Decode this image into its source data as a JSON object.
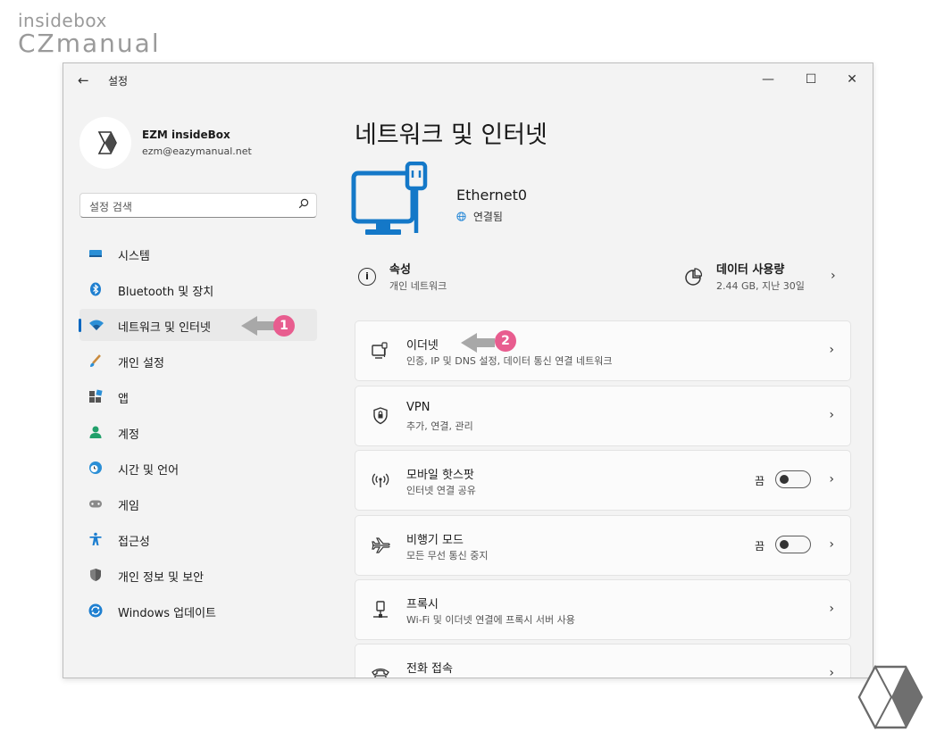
{
  "brand": {
    "line1": "insidebox",
    "line2": "CZmanual"
  },
  "window": {
    "title": "설정",
    "back_icon": "←",
    "minimize": "—",
    "maximize": "☐",
    "close": "✕"
  },
  "profile": {
    "name": "EZM insideBox",
    "email": "ezm@eazymanual.net"
  },
  "search": {
    "placeholder": "설정 검색",
    "icon": "search-icon"
  },
  "sidebar": {
    "items": [
      {
        "label": "시스템",
        "icon": "system-display-icon",
        "active": false
      },
      {
        "label": "Bluetooth 및 장치",
        "icon": "bluetooth-icon",
        "active": false
      },
      {
        "label": "네트워크 및 인터넷",
        "icon": "wifi-network-icon",
        "active": true
      },
      {
        "label": "개인 설정",
        "icon": "brush-icon",
        "active": false
      },
      {
        "label": "앱",
        "icon": "apps-icon",
        "active": false
      },
      {
        "label": "계정",
        "icon": "account-icon",
        "active": false
      },
      {
        "label": "시간 및 언어",
        "icon": "clock-globe-icon",
        "active": false
      },
      {
        "label": "게임",
        "icon": "gamepad-icon",
        "active": false
      },
      {
        "label": "접근성",
        "icon": "accessibility-icon",
        "active": false
      },
      {
        "label": "개인 정보 및 보안",
        "icon": "shield-icon",
        "active": false
      },
      {
        "label": "Windows 업데이트",
        "icon": "windows-update-icon",
        "active": false
      }
    ]
  },
  "main": {
    "title": "네트워크 및 인터넷",
    "ethernet": {
      "name": "Ethernet0",
      "status": "연결됨"
    },
    "properties": {
      "title": "속성",
      "subtitle": "개인 네트워크"
    },
    "data_usage": {
      "title": "데이터 사용량",
      "subtitle": "2.44 GB, 지난 30일"
    },
    "cards": [
      {
        "title": "이더넷",
        "subtitle": "인증, IP 및 DNS 설정, 데이터 통신 연결 네트워크",
        "icon": "ethernet-icon"
      },
      {
        "title": "VPN",
        "subtitle": "추가, 연결, 관리",
        "icon": "vpn-shield-icon"
      },
      {
        "title": "모바일 핫스팟",
        "subtitle": "인터넷 연결 공유",
        "icon": "hotspot-icon",
        "toggle_state": "끔",
        "toggle_on": false
      },
      {
        "title": "비행기 모드",
        "subtitle": "모든 무선 통신 중지",
        "icon": "airplane-icon",
        "toggle_state": "끔",
        "toggle_on": false
      },
      {
        "title": "프록시",
        "subtitle": "Wi-Fi 및 이더넷 연결에 프록시 서버 사용",
        "icon": "proxy-icon"
      },
      {
        "title": "전화 접속",
        "subtitle": "",
        "icon": "dialup-phone-icon"
      }
    ]
  },
  "callouts": {
    "one": "1",
    "two": "2"
  },
  "colors": {
    "accent": "#0067c0",
    "callout": "#e85d8f",
    "window_bg": "#f3f3f3"
  }
}
